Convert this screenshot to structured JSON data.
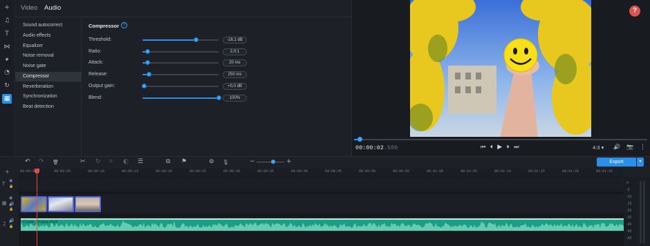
{
  "tabs": [
    {
      "label": "Video"
    },
    {
      "label": "Audio"
    }
  ],
  "sidebar_items": [
    {
      "label": "Sound autocorrect"
    },
    {
      "label": "Audio effects"
    },
    {
      "label": "Equalizer"
    },
    {
      "label": "Noise removal"
    },
    {
      "label": "Noise gate"
    },
    {
      "label": "Compressor",
      "selected": true
    },
    {
      "label": "Reverberation"
    },
    {
      "label": "Synchronization"
    },
    {
      "label": "Beat detection"
    }
  ],
  "compressor": {
    "title": "Compressor",
    "help_icon": "?",
    "params": [
      {
        "label": "Threshold:",
        "value": "-18,1 dB",
        "level": 0.7
      },
      {
        "label": "Ratio:",
        "value": "2,0:1",
        "level": 0.06
      },
      {
        "label": "Attack:",
        "value": "20 ms",
        "level": 0.06
      },
      {
        "label": "Release:",
        "value": "250 ms",
        "level": 0.08
      },
      {
        "label": "Output gain:",
        "value": "+0,0 dB",
        "level": 0.02
      },
      {
        "label": "Blend:",
        "value": "100%",
        "level": 1.0
      }
    ]
  },
  "preview": {
    "timecode_main": "00:00:02",
    "timecode_frac": ".500",
    "aspect": "4:3",
    "aspect_chevron": "▾",
    "help_badge": "?",
    "playback_progress": 0.02
  },
  "timeline_toolbar": {
    "export_label": "Export",
    "zoom_minus": "−",
    "zoom_plus": "+",
    "zoom_level": 0.6
  },
  "ruler_ticks": [
    "00:00:00",
    "00:00:05",
    "00:00:10",
    "00:00:15",
    "00:00:20",
    "00:00:25",
    "00:00:30",
    "00:00:35",
    "00:00:40",
    "00:00:45",
    "00:00:50",
    "00:00:55",
    "00:01:00",
    "00:01:05",
    "00:01:10",
    "00:01:15",
    "00:01:20",
    "00:01:25"
  ],
  "audio_clip": {
    "name": "Crane_Bruise.mp3"
  },
  "meter_labels": [
    "0",
    "-5",
    "-10",
    "-15",
    "-20",
    "-30",
    "-40",
    "-50",
    "-60"
  ],
  "colors": {
    "accent": "#2a8fe8",
    "audio": "#1d9d86",
    "playhead": "#e04b4b",
    "help": "#d9534f"
  },
  "icons": {
    "add": "+",
    "music": "♫",
    "title": "T",
    "transition": "⋈",
    "magic": "✦",
    "sticker": "◔",
    "rotate": "↻",
    "effects": "▦",
    "undo": "↶",
    "redo": "↷",
    "delete": "🗑",
    "cut": "✂",
    "rotate_clip": "↻",
    "crop": "⌗",
    "color": "◐",
    "list": "☰",
    "overlay": "⧉",
    "flag": "⚑",
    "record": "⊚",
    "mic": "🎙",
    "prev": "⏮",
    "step_back": "⏴",
    "play": "▶",
    "step_fwd": "⏵",
    "next": "⏭",
    "volume": "🔊",
    "snapshot": "📷",
    "more": "⋮",
    "eye": "◉",
    "lock": "🔒",
    "chevron": "▾"
  }
}
